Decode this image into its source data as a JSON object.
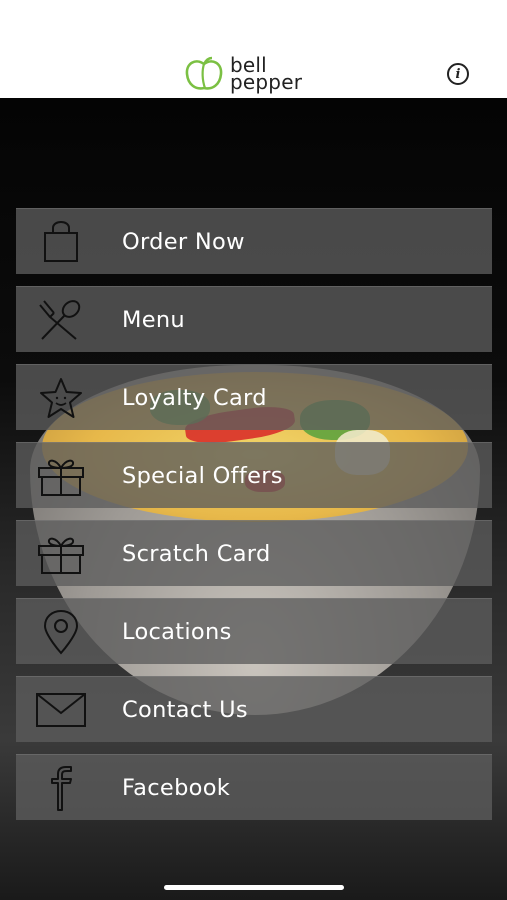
{
  "header": {
    "logo_line1": "bell",
    "logo_line2": "pepper",
    "info_icon": "i"
  },
  "menu": {
    "items": [
      {
        "label": "Order Now",
        "icon": "shopping-bag-icon"
      },
      {
        "label": "Menu",
        "icon": "spoon-fork-icon"
      },
      {
        "label": "Loyalty Card",
        "icon": "star-face-icon"
      },
      {
        "label": "Special Offers",
        "icon": "gift-icon"
      },
      {
        "label": "Scratch Card",
        "icon": "gift-icon"
      },
      {
        "label": "Locations",
        "icon": "location-pin-icon"
      },
      {
        "label": "Contact Us",
        "icon": "envelope-icon"
      },
      {
        "label": "Facebook",
        "icon": "facebook-icon"
      }
    ]
  },
  "colors": {
    "logo_green": "#7bc043",
    "tile_bg": "#5c5c5c",
    "icon_stroke": "#111111"
  }
}
